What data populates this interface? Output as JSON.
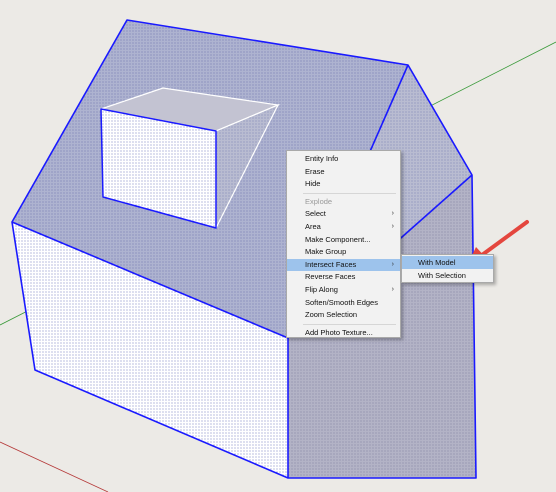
{
  "context_menu": {
    "items": [
      {
        "label": "Entity Info"
      },
      {
        "label": "Erase"
      },
      {
        "label": "Hide"
      },
      {
        "label": "Explode",
        "disabled": true
      },
      {
        "label": "Select",
        "submenu": true
      },
      {
        "label": "Area",
        "submenu": true
      },
      {
        "label": "Make Component..."
      },
      {
        "label": "Make Group"
      },
      {
        "label": "Intersect Faces",
        "submenu": true,
        "highlighted": true
      },
      {
        "label": "Reverse Faces"
      },
      {
        "label": "Flip Along",
        "submenu": true
      },
      {
        "label": "Soften/Smooth Edges"
      },
      {
        "label": "Zoom Selection"
      },
      {
        "label": "Add Photo Texture..."
      }
    ],
    "submenu_arrow": "›"
  },
  "submenu": {
    "items": [
      {
        "label": "With Model",
        "highlighted": true
      },
      {
        "label": "With Selection"
      }
    ]
  },
  "colors": {
    "background": "#eceae6",
    "selection_edge": "#1a1aff",
    "menu_highlight": "#9dc3ec",
    "annotation_arrow": "#e4463e",
    "axis_red": "#b53a3a",
    "axis_green": "#3a9a3a"
  }
}
